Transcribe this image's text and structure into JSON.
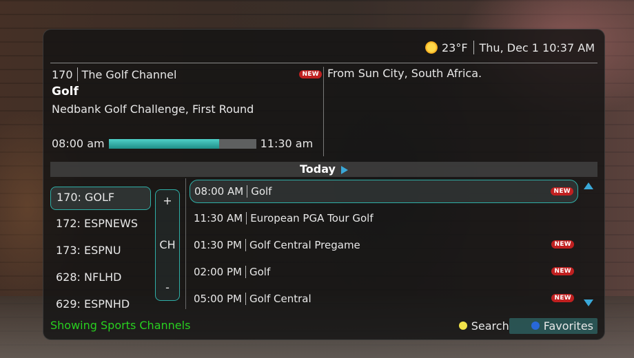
{
  "header": {
    "weather_icon": "sun-icon",
    "temperature": "23°F",
    "datetime": "Thu, Dec 1 10:37 AM"
  },
  "current_program": {
    "channel_number": "170",
    "channel_name": "The Golf Channel",
    "new_badge": "NEW",
    "title": "Golf",
    "episode": "Nedbank Golf Challenge, First Round",
    "start_time": "08:00 am",
    "end_time": "11:30 am",
    "progress_fraction": 0.75,
    "description": "From Sun City, South Africa."
  },
  "day_nav": {
    "label": "Today"
  },
  "channels": [
    {
      "label": "170: GOLF",
      "selected": true
    },
    {
      "label": "172: ESPNEWS",
      "selected": false
    },
    {
      "label": "173: ESPNU",
      "selected": false
    },
    {
      "label": "628: NFLHD",
      "selected": false
    },
    {
      "label": "629: ESPNHD",
      "selected": false
    }
  ],
  "ch_control": {
    "plus": "+",
    "label": "CH",
    "minus": "-"
  },
  "programs": [
    {
      "time": "08:00 AM",
      "title": "Golf",
      "badge": "NEW",
      "selected": true
    },
    {
      "time": "11:30 AM",
      "title": "European PGA Tour Golf",
      "badge": "",
      "selected": false
    },
    {
      "time": "01:30 PM",
      "title": "Golf Central Pregame",
      "badge": "NEW",
      "selected": false
    },
    {
      "time": "02:00 PM",
      "title": "Golf",
      "badge": "NEW",
      "selected": false
    },
    {
      "time": "05:00 PM",
      "title": "Golf Central",
      "badge": "NEW",
      "selected": false
    }
  ],
  "footer": {
    "status": "Showing Sports Channels",
    "search_label": "Search",
    "favorites_label": "Favorites"
  },
  "colors": {
    "accent": "#2fb0a8",
    "status_text": "#28d020",
    "new_badge": "#c02020",
    "search_button": "#f2e34a",
    "favorites_button": "#2868d8"
  }
}
